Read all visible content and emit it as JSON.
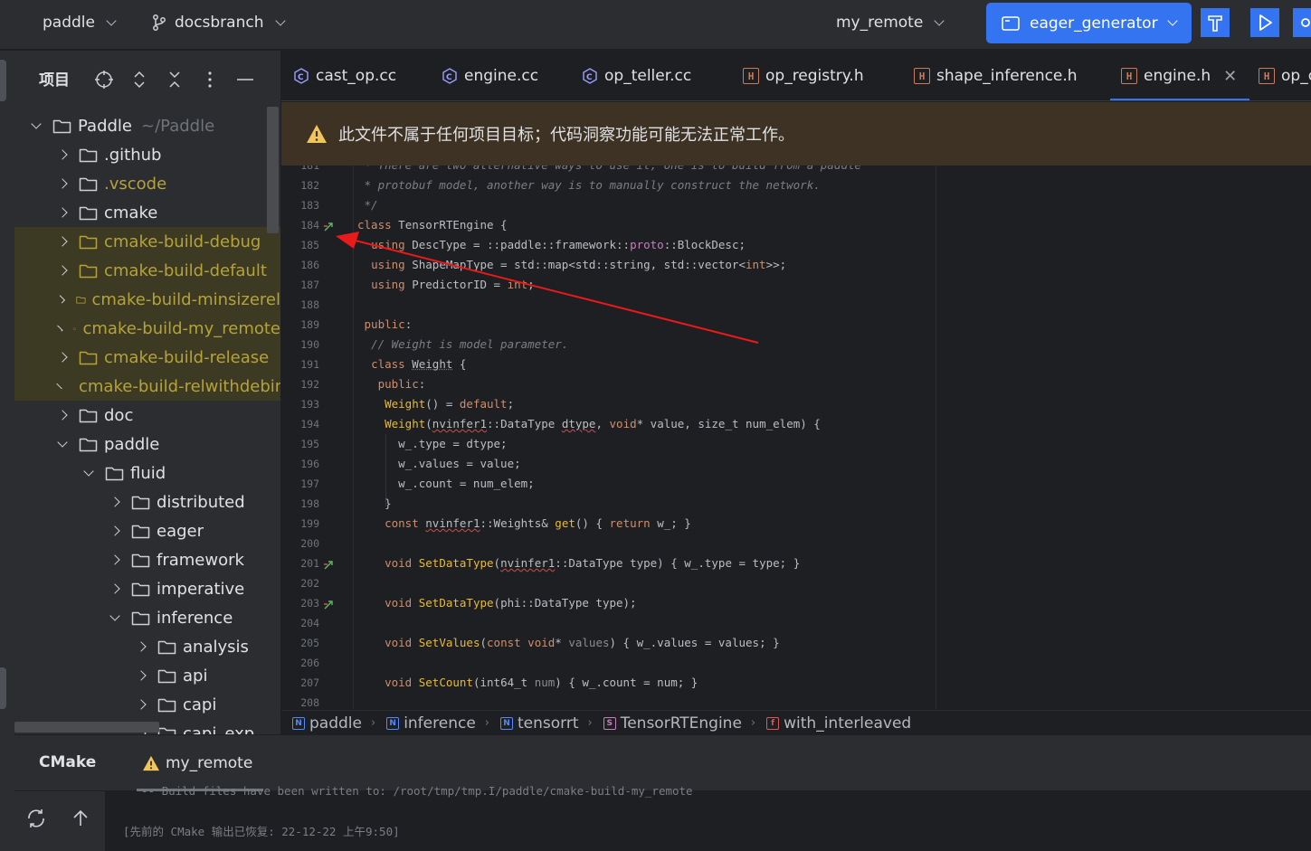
{
  "toolbar": {
    "project": "paddle",
    "branch": "docsbranch",
    "remote": "my_remote",
    "run_config": "eager_generator"
  },
  "project_panel": {
    "title": "项目",
    "tree": [
      {
        "name": "Paddle",
        "hint": "~/Paddle",
        "depth": 0,
        "open": true,
        "excluded": false
      },
      {
        "name": ".github",
        "depth": 1,
        "open": false,
        "excluded": false
      },
      {
        "name": ".vscode",
        "depth": 1,
        "open": false,
        "excluded": false,
        "color": "#b5a23a"
      },
      {
        "name": "cmake",
        "depth": 1,
        "open": false,
        "excluded": false
      },
      {
        "name": "cmake-build-debug",
        "depth": 1,
        "open": false,
        "excluded": true
      },
      {
        "name": "cmake-build-default",
        "depth": 1,
        "open": false,
        "excluded": true
      },
      {
        "name": "cmake-build-minsizerel",
        "depth": 1,
        "open": false,
        "excluded": true
      },
      {
        "name": "cmake-build-my_remote",
        "depth": 1,
        "open": false,
        "excluded": true
      },
      {
        "name": "cmake-build-release",
        "depth": 1,
        "open": false,
        "excluded": true
      },
      {
        "name": "cmake-build-relwithdebinfo",
        "depth": 1,
        "open": false,
        "excluded": true
      },
      {
        "name": "doc",
        "depth": 1,
        "open": false,
        "excluded": false
      },
      {
        "name": "paddle",
        "depth": 1,
        "open": true,
        "excluded": false
      },
      {
        "name": "fluid",
        "depth": 2,
        "open": true,
        "excluded": false
      },
      {
        "name": "distributed",
        "depth": 3,
        "open": false,
        "excluded": false
      },
      {
        "name": "eager",
        "depth": 3,
        "open": false,
        "excluded": false
      },
      {
        "name": "framework",
        "depth": 3,
        "open": false,
        "excluded": false
      },
      {
        "name": "imperative",
        "depth": 3,
        "open": false,
        "excluded": false
      },
      {
        "name": "inference",
        "depth": 3,
        "open": true,
        "excluded": false
      },
      {
        "name": "analysis",
        "depth": 4,
        "open": false,
        "excluded": false
      },
      {
        "name": "api",
        "depth": 4,
        "open": false,
        "excluded": false
      },
      {
        "name": "capi",
        "depth": 4,
        "open": false,
        "excluded": false
      },
      {
        "name": "capi_exp",
        "depth": 4,
        "open": false,
        "excluded": false
      }
    ]
  },
  "tabs": [
    {
      "label": "cast_op.cc",
      "kind": "cc",
      "active": false
    },
    {
      "label": "engine.cc",
      "kind": "cc",
      "active": false
    },
    {
      "label": "op_teller.cc",
      "kind": "cc",
      "active": false
    },
    {
      "label": "op_registry.h",
      "kind": "h",
      "active": false
    },
    {
      "label": "shape_inference.h",
      "kind": "h",
      "active": false
    },
    {
      "label": "engine.h",
      "kind": "h",
      "active": true
    },
    {
      "label": "op_converter.h",
      "kind": "h",
      "active": false
    }
  ],
  "banner": {
    "text": "此文件不属于任何项目目标；代码洞察功能可能无法正常工作。"
  },
  "code": {
    "lines": [
      {
        "n": "181",
        "html": "<span class='cm'> * There are two alternative ways to use it, one is to build from a paddle</span>"
      },
      {
        "n": "182",
        "html": "<span class='cm'> * protobuf model, another way is to manually construct the network.</span>"
      },
      {
        "n": "183",
        "html": "<span class='cm'> */</span>"
      },
      {
        "n": "184",
        "html": "<span class='kw'>class</span> TensorRTEngine {"
      },
      {
        "n": "185",
        "html": "  <span class='kw'>using</span> DescType = ::paddle::framework::<span class='ma'>proto</span>::BlockDesc;"
      },
      {
        "n": "186",
        "html": "  <span class='kw'>using</span> ShapeMapType = std::map&lt;std::string, std::vector&lt;<span class='kw'>int</span>&gt;&gt;;"
      },
      {
        "n": "187",
        "html": "  <span class='kw'>using</span> PredictorID = <span class='kw'>int</span>;"
      },
      {
        "n": "188",
        "html": ""
      },
      {
        "n": "189",
        "html": " <span class='kw'>public</span>:"
      },
      {
        "n": "190",
        "html": "  <span class='cm'>// Weight is model parameter.</span>"
      },
      {
        "n": "191",
        "html": "  <span class='kw'>class</span> <span class='ul2'>Weight</span> {"
      },
      {
        "n": "192",
        "html": "   <span class='kw'>public</span>:"
      },
      {
        "n": "193",
        "html": "    <span class='fn'>Weight</span>() = <span class='kw'>default</span>;"
      },
      {
        "n": "194",
        "html": "    <span class='fn'>Weight</span>(<span class='ul'>nvinfer1</span>::DataType <span class='ul'>dtype</span>, <span class='kw'>void</span>* value, size_t num_elem) {"
      },
      {
        "n": "195",
        "html": "      w_.type = dtype;"
      },
      {
        "n": "196",
        "html": "      w_.values = value;"
      },
      {
        "n": "197",
        "html": "      w_.count = num_elem;"
      },
      {
        "n": "198",
        "html": "    }"
      },
      {
        "n": "199",
        "html": "    <span class='kw'>const</span> <span class='ul'>nvinfer1</span>::Weights&amp; <span class='fn'>get</span>() { <span class='kw'>return</span> w_; }"
      },
      {
        "n": "200",
        "html": ""
      },
      {
        "n": "201",
        "html": "    <span class='kw'>void</span> <span class='fn'>SetDataType</span>(<span class='ul'>nvinfer1</span>::DataType type) { w_.type = type; }"
      },
      {
        "n": "202",
        "html": ""
      },
      {
        "n": "203",
        "html": "    <span class='kw'>void</span> <span class='fn'>SetDataType</span>(phi::DataType type);"
      },
      {
        "n": "204",
        "html": ""
      },
      {
        "n": "205",
        "html": "    <span class='kw'>void</span> <span class='fn'>SetValues</span>(<span class='kw'>const void</span>* <span class='pl'>values</span>) { w_.values = values; }"
      },
      {
        "n": "206",
        "html": ""
      },
      {
        "n": "207",
        "html": "    <span class='kw'>void</span> <span class='fn'>SetCount</span>(int64_t <span class='pl'>num</span>) { w_.count = num; }"
      },
      {
        "n": "208",
        "html": ""
      }
    ]
  },
  "breadcrumb": [
    {
      "icon": "N",
      "label": "paddle"
    },
    {
      "icon": "N",
      "label": "inference"
    },
    {
      "icon": "N",
      "label": "tensorrt"
    },
    {
      "icon": "S",
      "label": "TensorRTEngine"
    },
    {
      "icon": "f",
      "label": "with_interleaved"
    }
  ],
  "bottom_panel": {
    "title": "CMake",
    "tab": "my_remote",
    "console_line1": "-- Build files have been written to: /root/tmp/tmp.I/paddle/cmake-build-my_remote",
    "console_line2": "[先前的 CMake 输出已恢复: 22-12-22 上午9:50]"
  },
  "colors": {
    "accent": "#3574f0",
    "warning": "#f2c55c",
    "excluded_text": "#b5a23a",
    "annotation_arrow": "#e81a1a"
  }
}
